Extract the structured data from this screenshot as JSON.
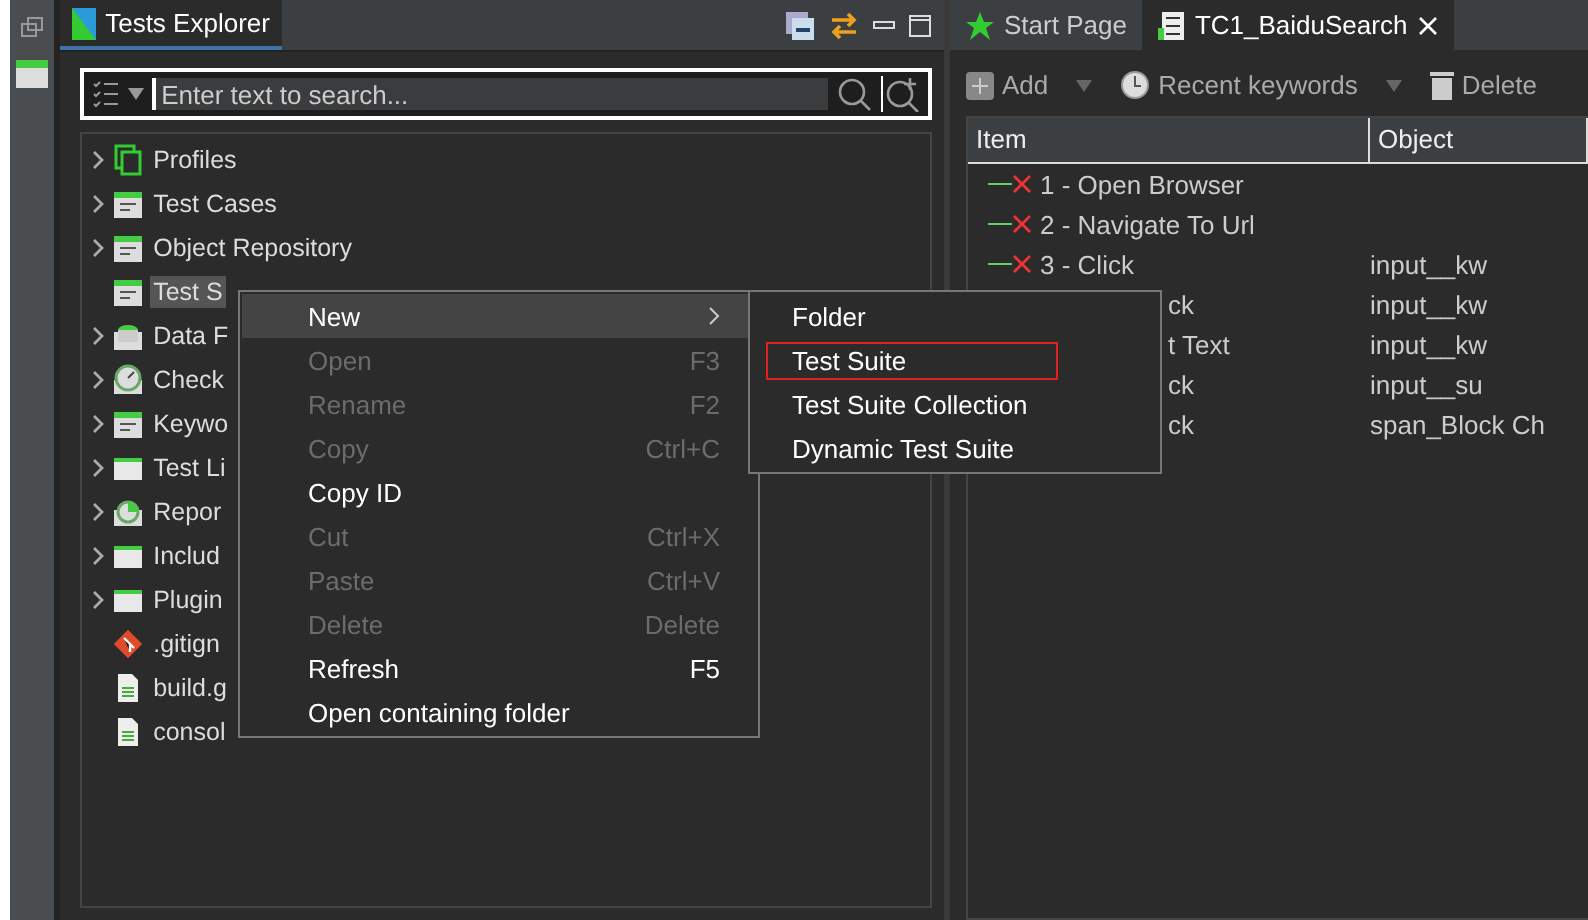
{
  "explorer": {
    "title": "Tests Explorer",
    "search": {
      "placeholder": "Enter text to search..."
    },
    "tree": [
      {
        "label": "Profiles",
        "expandable": true,
        "selected": false
      },
      {
        "label": "Test Cases",
        "expandable": true,
        "selected": false
      },
      {
        "label": "Object Repository",
        "expandable": true,
        "selected": false
      },
      {
        "label": "Test S",
        "expandable": false,
        "selected": true
      },
      {
        "label": "Data F",
        "expandable": true,
        "selected": false
      },
      {
        "label": "Check",
        "expandable": true,
        "selected": false
      },
      {
        "label": "Keywo",
        "expandable": true,
        "selected": false
      },
      {
        "label": "Test Li",
        "expandable": true,
        "selected": false
      },
      {
        "label": "Repor",
        "expandable": true,
        "selected": false
      },
      {
        "label": "Includ",
        "expandable": true,
        "selected": false
      },
      {
        "label": "Plugin",
        "expandable": true,
        "selected": false
      },
      {
        "label": ".gitign",
        "expandable": false,
        "selected": false
      },
      {
        "label": "build.g",
        "expandable": false,
        "selected": false
      },
      {
        "label": "consol",
        "expandable": false,
        "selected": false
      }
    ]
  },
  "context_menu": [
    {
      "label": "New",
      "disabled": false,
      "submenu": true,
      "selected": true
    },
    {
      "label": "Open",
      "shortcut": "F3",
      "disabled": true,
      "submenu": false,
      "selected": false
    },
    {
      "label": "Rename",
      "shortcut": "F2",
      "disabled": true,
      "submenu": false,
      "selected": false
    },
    {
      "label": "Copy",
      "shortcut": "Ctrl+C",
      "disabled": true,
      "submenu": false,
      "selected": false
    },
    {
      "label": "Copy ID",
      "disabled": false,
      "submenu": false,
      "selected": false
    },
    {
      "label": "Cut",
      "shortcut": "Ctrl+X",
      "disabled": true,
      "submenu": false,
      "selected": false
    },
    {
      "label": "Paste",
      "shortcut": "Ctrl+V",
      "disabled": true,
      "submenu": false,
      "selected": false
    },
    {
      "label": "Delete",
      "shortcut": "Delete",
      "disabled": true,
      "submenu": false,
      "selected": false
    },
    {
      "label": "Refresh",
      "shortcut": "F5",
      "disabled": false,
      "submenu": false,
      "selected": false
    },
    {
      "label": "Open containing folder",
      "disabled": false,
      "submenu": false,
      "selected": false
    }
  ],
  "submenu": [
    {
      "label": "Folder",
      "selected": false
    },
    {
      "label": "Test Suite",
      "selected": true
    },
    {
      "label": "Test Suite Collection",
      "selected": false
    },
    {
      "label": "Dynamic Test Suite",
      "selected": false
    }
  ],
  "editor": {
    "tabs": [
      {
        "label": "Start Page",
        "kind": "start",
        "selected": false
      },
      {
        "label": "TC1_BaiduSearch",
        "kind": "testcase",
        "selected": true
      }
    ],
    "toolbar": [
      "Add",
      "Recent keywords",
      "Delete"
    ],
    "table": {
      "columns": [
        "Item",
        "Object"
      ],
      "rows": [
        {
          "item": "1 - Open Browser",
          "object": "",
          "kind": "step"
        },
        {
          "item": "2 - Navigate To Url",
          "object": "",
          "kind": "step"
        },
        {
          "item": "3 - Click",
          "object": "input__kw",
          "kind": "step"
        },
        {
          "item": "ck",
          "object": "input__kw",
          "kind": "covered"
        },
        {
          "item": "t Text",
          "object": "input__kw",
          "kind": "covered"
        },
        {
          "item": "ck",
          "object": "input__su",
          "kind": "covered"
        },
        {
          "item": "ck",
          "object": "span_Block Ch",
          "kind": "covered"
        }
      ]
    }
  }
}
